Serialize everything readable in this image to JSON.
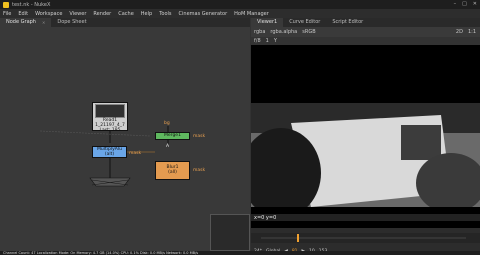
{
  "app": {
    "title": "test.nk - NukeX"
  },
  "menu": [
    "File",
    "Edit",
    "Workspace",
    "Viewer",
    "Render",
    "Cache",
    "Help",
    "Tools",
    "Cinemas Generator",
    "HoM Manager"
  ],
  "left_tabs": [
    {
      "label": "Node Graph"
    },
    {
      "label": "Dope Sheet"
    }
  ],
  "right_tabs": [
    {
      "label": "Viewer1"
    },
    {
      "label": "Curve Editor"
    },
    {
      "label": "Script Editor"
    }
  ],
  "nodes": {
    "read": {
      "name": "Read1",
      "sub": "1_21197_4_7",
      "detail": "Last: 185"
    },
    "multiply": {
      "name": "MultiplyAlu",
      "sub": "(alt)"
    },
    "merge": {
      "name": "Merge1"
    },
    "blur": {
      "name": "Blur1",
      "sub": "(all)"
    },
    "mask_labels": [
      "mask",
      "mask",
      "mask"
    ],
    "bg_label": "bg",
    "connector_a": "A"
  },
  "viewer": {
    "channel_a": "rgba",
    "channel_b": "rgba.alpha",
    "colorspace": "sRGB",
    "zoom": "1:1",
    "mode": "2D",
    "frame_label": "f/8",
    "gain": "1",
    "gamma": "Y",
    "coords": "x=0 y=0"
  },
  "timeline": {
    "fps": "24*",
    "range_mode": "Global",
    "current_frame": "81",
    "step": "10",
    "end": "153",
    "ticks": [
      "1",
      "52",
      "66"
    ]
  },
  "status": "Channel Count: 47  Localization Mode: On  Memory: 4.7 GB (14.0%)  CPU: 0.1%  Disk: 0.0 MB/s  Network: 0.0 MB/s",
  "colors": {
    "accent": "#f0a030",
    "merge": "#5fb85f",
    "blur": "#e49b50",
    "multiply": "#6aa6e8"
  }
}
